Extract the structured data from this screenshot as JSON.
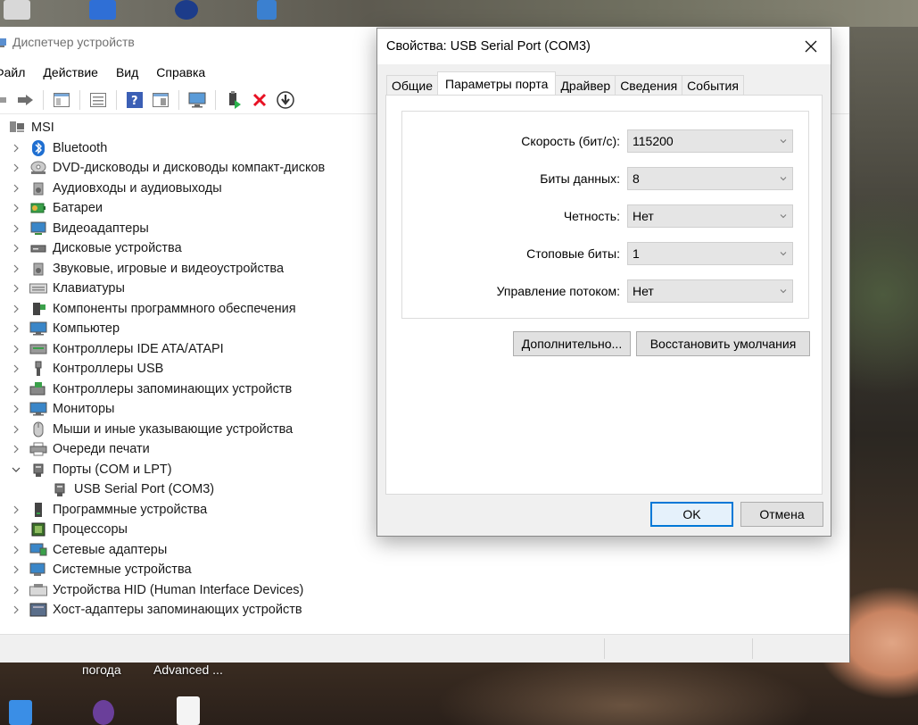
{
  "desktop": {
    "bottom_labels": [
      "погода",
      "Advanced ..."
    ]
  },
  "device_manager": {
    "title": "Диспетчер устройств",
    "menu": [
      "Файл",
      "Действие",
      "Вид",
      "Справка"
    ],
    "toolbar": [
      "back-icon",
      "forward-icon",
      "show-hide-tree-icon",
      "properties-icon",
      "help-icon",
      "view-icon",
      "monitor-scan-icon",
      "update-driver-icon",
      "uninstall-icon",
      "disable-icon"
    ],
    "root": "MSI",
    "categories": [
      {
        "label": "Bluetooth",
        "icon": "bluetooth-icon",
        "expanded": false
      },
      {
        "label": "DVD-дисководы и дисководы компакт-дисков",
        "icon": "dvd-icon",
        "expanded": false
      },
      {
        "label": "Аудиовходы и аудиовыходы",
        "icon": "speaker-icon",
        "expanded": false
      },
      {
        "label": "Батареи",
        "icon": "battery-icon",
        "expanded": false
      },
      {
        "label": "Видеоадаптеры",
        "icon": "display-adapter-icon",
        "expanded": false
      },
      {
        "label": "Дисковые устройства",
        "icon": "disk-icon",
        "expanded": false
      },
      {
        "label": "Звуковые, игровые и видеоустройства",
        "icon": "sound-icon",
        "expanded": false
      },
      {
        "label": "Клавиатуры",
        "icon": "keyboard-icon",
        "expanded": false
      },
      {
        "label": "Компоненты программного обеспечения",
        "icon": "software-component-icon",
        "expanded": false
      },
      {
        "label": "Компьютер",
        "icon": "computer-icon",
        "expanded": false
      },
      {
        "label": "Контроллеры IDE ATA/ATAPI",
        "icon": "ide-icon",
        "expanded": false
      },
      {
        "label": "Контроллеры USB",
        "icon": "usb-icon",
        "expanded": false
      },
      {
        "label": "Контроллеры запоминающих устройств",
        "icon": "storage-controller-icon",
        "expanded": false
      },
      {
        "label": "Мониторы",
        "icon": "monitor-icon",
        "expanded": false
      },
      {
        "label": "Мыши и иные указывающие устройства",
        "icon": "mouse-icon",
        "expanded": false
      },
      {
        "label": "Очереди печати",
        "icon": "printer-icon",
        "expanded": false
      },
      {
        "label": "Порты (COM и LPT)",
        "icon": "port-icon",
        "expanded": true,
        "children": [
          "USB Serial Port (COM3)"
        ]
      },
      {
        "label": "Программные устройства",
        "icon": "software-device-icon",
        "expanded": false
      },
      {
        "label": "Процессоры",
        "icon": "processor-icon",
        "expanded": false
      },
      {
        "label": "Сетевые адаптеры",
        "icon": "network-adapter-icon",
        "expanded": false
      },
      {
        "label": "Системные устройства",
        "icon": "system-device-icon",
        "expanded": false
      },
      {
        "label": "Устройства HID (Human Interface Devices)",
        "icon": "hid-icon",
        "expanded": false
      },
      {
        "label": "Хост-адаптеры запоминающих устройств",
        "icon": "storage-host-icon",
        "expanded": false
      }
    ]
  },
  "dialog": {
    "title": "Свойства: USB Serial Port (COM3)",
    "tabs": [
      "Общие",
      "Параметры порта",
      "Драйвер",
      "Сведения",
      "События"
    ],
    "active_tab": "Параметры порта",
    "fields": [
      {
        "label": "Скорость (бит/с):",
        "value": "115200"
      },
      {
        "label": "Биты данных:",
        "value": "8"
      },
      {
        "label": "Четность:",
        "value": "Нет"
      },
      {
        "label": "Стоповые биты:",
        "value": "1"
      },
      {
        "label": "Управление потоком:",
        "value": "Нет"
      }
    ],
    "advanced_button": "Дополнительно...",
    "restore_button": "Восстановить умолчания",
    "ok_button": "OK",
    "cancel_button": "Отмена"
  },
  "colors": {
    "accent": "#0078d7",
    "dialog_bg": "#f0f0f0",
    "button_bg": "#e1e1e1",
    "uninstall_red": "#e81123"
  }
}
